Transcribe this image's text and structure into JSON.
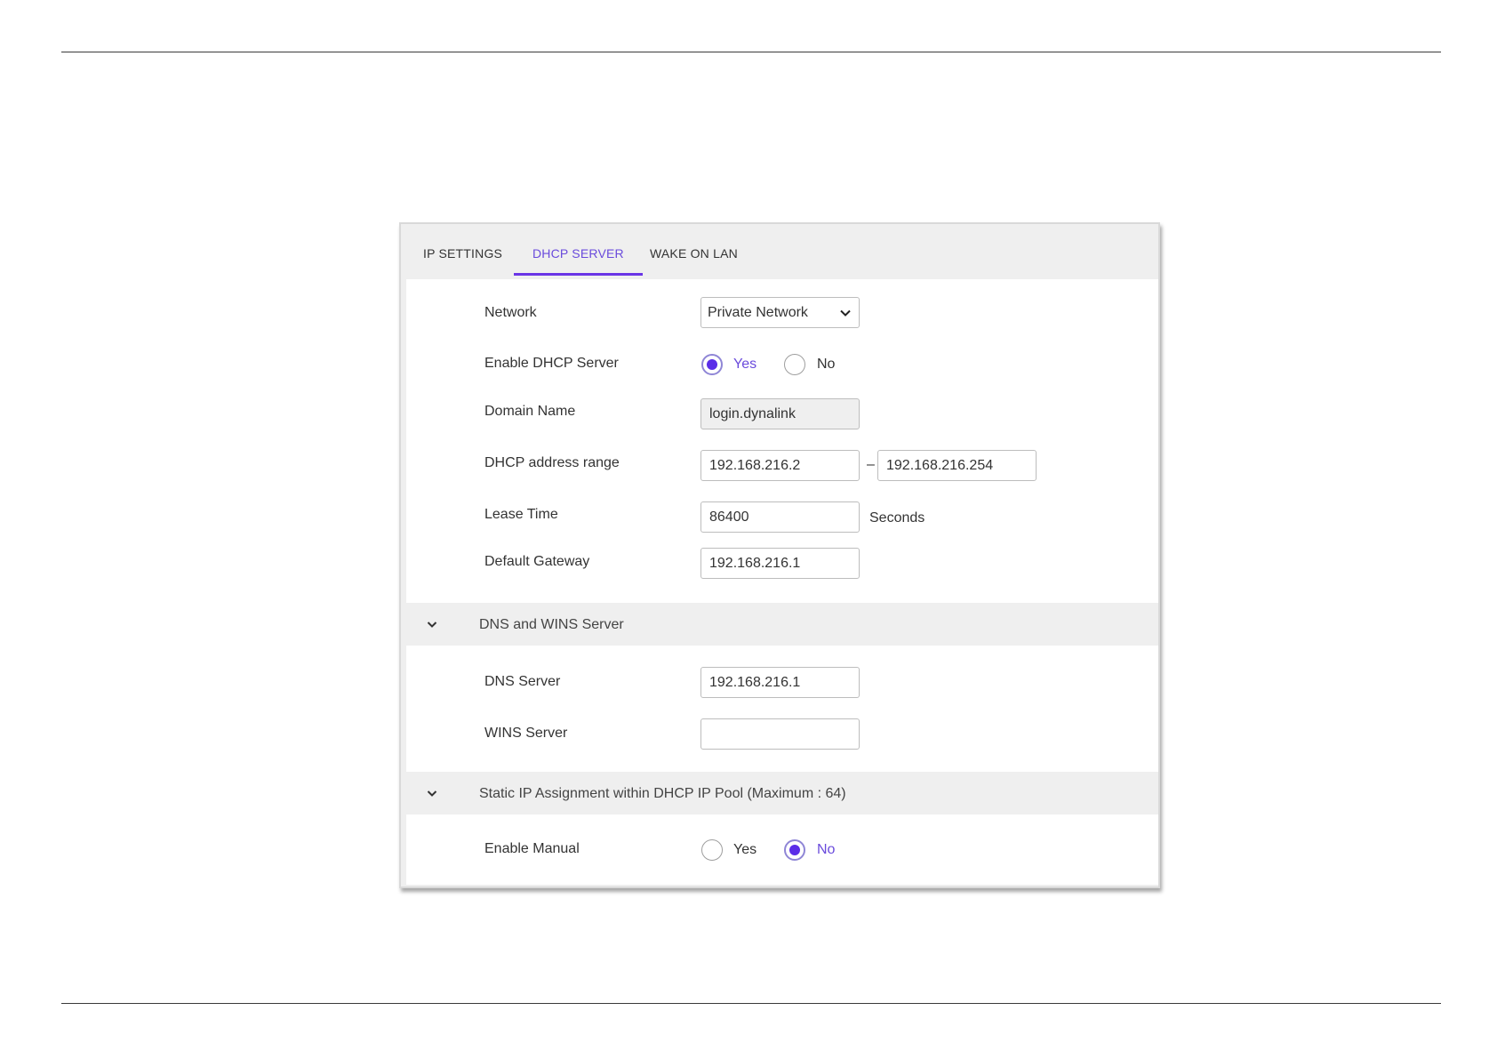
{
  "tabs": [
    {
      "label": "IP SETTINGS",
      "active": false
    },
    {
      "label": "DHCP SERVER",
      "active": true
    },
    {
      "label": "WAKE ON LAN",
      "active": false
    }
  ],
  "accent_color": "#6a35e6",
  "dhcp": {
    "network_label": "Network",
    "network_value": "Private Network",
    "enable_label": "Enable DHCP Server",
    "enable_yes": "Yes",
    "enable_no": "No",
    "enable_selected": "Yes",
    "domain_label": "Domain Name",
    "domain_value": "login.dynalink",
    "range_label": "DHCP address range",
    "range_start": "192.168.216.2",
    "range_separator": "–",
    "range_end": "192.168.216.254",
    "lease_label": "Lease Time",
    "lease_value": "86400",
    "lease_unit": "Seconds",
    "gateway_label": "Default Gateway",
    "gateway_value": "192.168.216.1"
  },
  "dns_section": {
    "title": "DNS and WINS Server",
    "dns_label": "DNS Server",
    "dns_value": "192.168.216.1",
    "wins_label": "WINS Server",
    "wins_value": ""
  },
  "static_section": {
    "title": "Static IP Assignment within DHCP IP Pool (Maximum : 64)",
    "manual_label": "Enable Manual",
    "manual_yes": "Yes",
    "manual_no": "No",
    "manual_selected": "No"
  },
  "icons": {
    "select_arrow": "chevron-down-icon",
    "section_toggle": "chevron-down-icon"
  }
}
